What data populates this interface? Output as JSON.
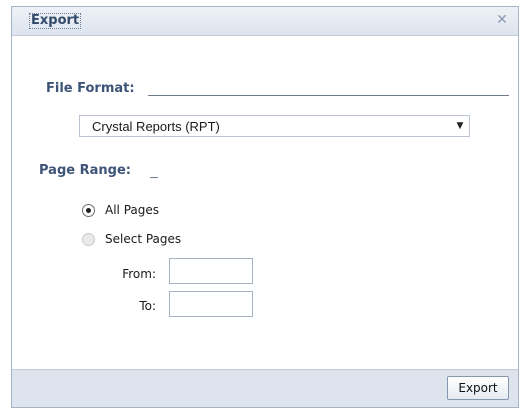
{
  "dialog": {
    "title": "Export",
    "close_icon": "✕"
  },
  "file_format": {
    "label": "File Format:",
    "selected": "Crystal Reports (RPT)",
    "arrow_icon": "▼"
  },
  "page_range": {
    "label": "Page Range:",
    "options": [
      {
        "label": "All Pages",
        "checked": true
      },
      {
        "label": "Select Pages",
        "checked": false
      }
    ],
    "from_label": "From:",
    "to_label": "To:",
    "from_value": "",
    "to_value": ""
  },
  "footer": {
    "export_label": "Export"
  }
}
